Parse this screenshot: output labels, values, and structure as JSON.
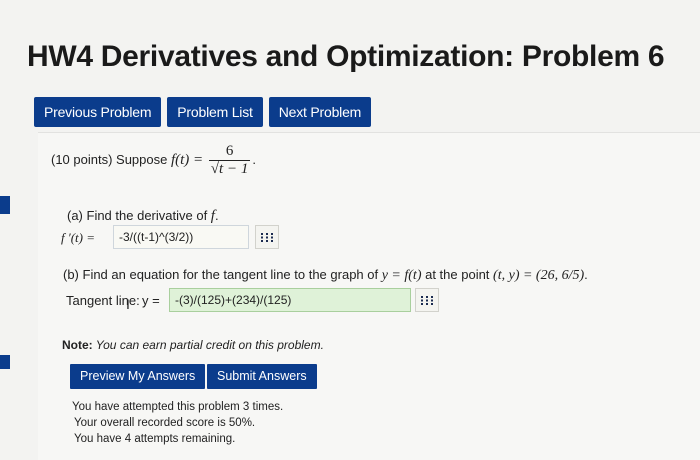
{
  "page": {
    "title": "HW4 Derivatives and Optimization: Problem 6"
  },
  "nav": {
    "previous": "Previous Problem",
    "list": "Problem List",
    "next": "Next Problem"
  },
  "problem": {
    "intro_prefix": "(10 points) Suppose ",
    "function_lhs": "f(t) =",
    "frac_num": "6",
    "frac_den": "t − 1",
    "intro_suffix": ".",
    "part_a": {
      "label": "(a) Find the derivative of ",
      "label_var": "f",
      "label_end": ".",
      "answer_lhs": "f ′(t) =",
      "answer_value": "-3/((t-1)^(3/2))"
    },
    "part_b": {
      "label_prefix": "(b) Find an equation for the tangent line to the graph of ",
      "label_math": "y = f(t)",
      "label_mid": " at the point ",
      "label_point": "(t, y) = (26, 6/5)",
      "label_end": ".",
      "answer_label": "Tangent line:",
      "answer_lhs": "y =",
      "answer_value": "-(3)/(125)+(234)/(125)"
    },
    "note_bold": "Note:",
    "note_text": " You can earn partial credit on this problem."
  },
  "actions": {
    "preview": "Preview My Answers",
    "submit": "Submit Answers"
  },
  "status": {
    "attempted": "You have attempted this problem 3 times.",
    "score": "Your overall recorded score is 50%.",
    "remaining": "You have 4 attempts remaining."
  },
  "icons": {
    "matrix": "grid-icon",
    "cursor": "text-cursor-icon"
  },
  "colors": {
    "accent": "#0b3c8c",
    "correct_field": "#dff2d8"
  }
}
